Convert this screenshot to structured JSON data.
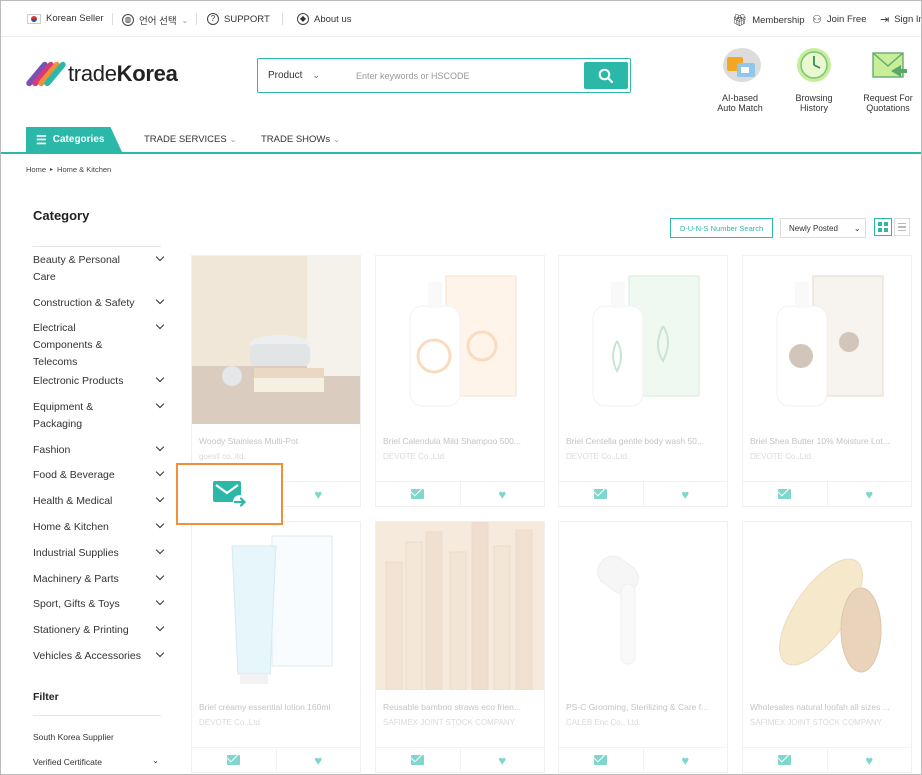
{
  "topbar": {
    "korean_seller": "Korean Seller",
    "language": "언어 선택",
    "support": "SUPPORT",
    "about": "About us",
    "membership": "Membership",
    "join": "Join Free",
    "signin": "Sign In"
  },
  "header": {
    "logo_prefix": "trade",
    "logo_bold": "Korea",
    "search_scope": "Product",
    "search_placeholder": "Enter keywords or HSCODE",
    "shortcuts": [
      {
        "label_1": "AI-based",
        "label_2": "Auto Match",
        "icon": "ai-match-icon"
      },
      {
        "label_1": "Browsing",
        "label_2": "History",
        "icon": "clock-icon"
      },
      {
        "label_1": "Request For",
        "label_2": "Quotations",
        "icon": "rfq-envelope-icon"
      }
    ]
  },
  "nav": {
    "categories": "Categories",
    "trade_services": "TRADE SERVICES",
    "trade_shows": "TRADE SHOWs"
  },
  "breadcrumb": {
    "home": "Home",
    "current": "Home & Kitchen"
  },
  "sidebar": {
    "title": "Category",
    "items": [
      "Beauty & Personal Care",
      "Construction & Safety",
      "Electrical Components & Telecoms",
      "Electronic Products",
      "Equipment & Packaging",
      "Fashion",
      "Food & Beverage",
      "Health & Medical",
      "Home & Kitchen",
      "Industrial Supplies",
      "Machinery & Parts",
      "Sport, Gifts & Toys",
      "Stationery & Printing",
      "Vehicles & Accessories"
    ],
    "filter_title": "Filter",
    "filters": [
      "South Korea Supplier",
      "Verified Certificate"
    ]
  },
  "toolbar": {
    "duns": "D-U-N-S Number Search",
    "sort": "Newly Posted"
  },
  "products": [
    {
      "name": "Woody Stainless Multi-Pot",
      "company": "goesll co.,ltd."
    },
    {
      "name": "Briel Calendula Mild Shampoo 500...",
      "company": "DEVOTE Co.,Ltd."
    },
    {
      "name": "Briel Centella gentle body wash 50...",
      "company": "DEVOTE Co.,Ltd."
    },
    {
      "name": "Briel Shea Butter 10% Moisture Lot...",
      "company": "DEVOTE Co.,Ltd."
    },
    {
      "name": "Briel creamy essential lotion 160ml",
      "company": "DEVOTE Co.,Ltd."
    },
    {
      "name": "Reusable bamboo straws eco frien...",
      "company": "SAFIMEX JOINT STOCK COMPANY"
    },
    {
      "name": "PS-C Grooming, Sterilizing & Care f...",
      "company": "CALEB Enc Co., Ltd."
    },
    {
      "name": "Wholesales natural loofah all sizes ...",
      "company": "SAFIMEX JOINT STOCK COMPANY"
    }
  ],
  "colors": {
    "accent": "#2cb8a8",
    "highlight": "#f0913a"
  }
}
